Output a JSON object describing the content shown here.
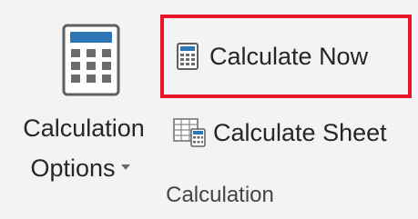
{
  "ribbon_group": {
    "title": "Calculation",
    "calculation_options": {
      "label_line1": "Calculation",
      "label_line2": "Options",
      "icon": "calculator-icon",
      "has_dropdown": true
    },
    "calculate_now": {
      "label": "Calculate Now",
      "icon": "calculator-icon",
      "highlighted": true
    },
    "calculate_sheet": {
      "label": "Calculate Sheet",
      "icon": "calculate-sheet-icon"
    }
  },
  "colors": {
    "background": "#f3f3f3",
    "highlight_border": "#e8142a",
    "icon_accent_blue": "#2e75b6",
    "text": "#262626"
  }
}
